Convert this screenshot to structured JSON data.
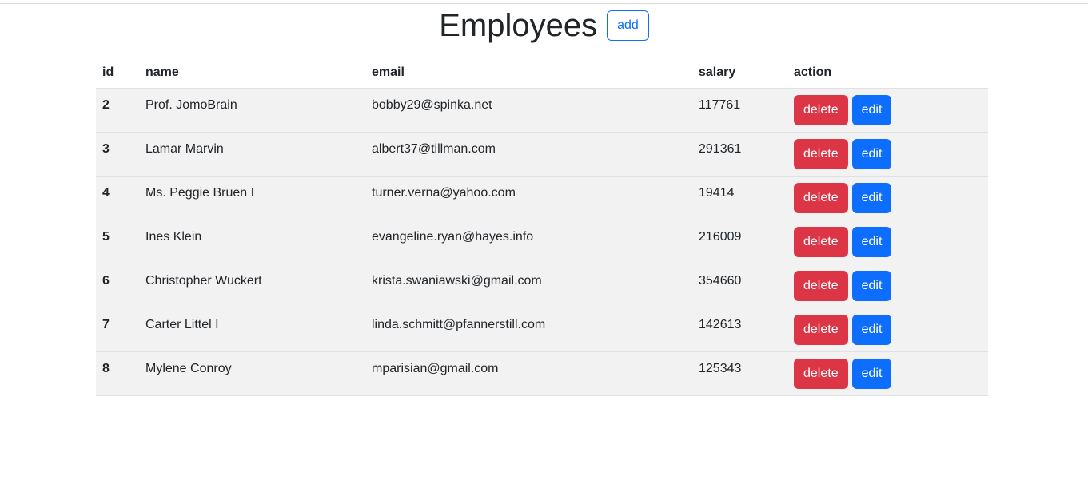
{
  "header": {
    "title": "Employees",
    "add_label": "add"
  },
  "table": {
    "columns": [
      "id",
      "name",
      "email",
      "salary",
      "action"
    ],
    "rows": [
      {
        "id": "2",
        "name": "Prof. JomoBrain",
        "email": "bobby29@spinka.net",
        "salary": "117761"
      },
      {
        "id": "3",
        "name": "Lamar Marvin",
        "email": "albert37@tillman.com",
        "salary": "291361"
      },
      {
        "id": "4",
        "name": "Ms. Peggie Bruen I",
        "email": "turner.verna@yahoo.com",
        "salary": "19414"
      },
      {
        "id": "5",
        "name": "Ines Klein",
        "email": "evangeline.ryan@hayes.info",
        "salary": "216009"
      },
      {
        "id": "6",
        "name": "Christopher Wuckert",
        "email": "krista.swaniawski@gmail.com",
        "salary": "354660"
      },
      {
        "id": "7",
        "name": "Carter Littel I",
        "email": "linda.schmitt@pfannerstill.com",
        "salary": "142613"
      },
      {
        "id": "8",
        "name": "Mylene Conroy",
        "email": "mparisian@gmail.com",
        "salary": "125343"
      }
    ],
    "delete_label": "delete",
    "edit_label": "edit"
  },
  "colors": {
    "delete": "#dc3545",
    "edit": "#0d6efd",
    "row_bg": "#f2f2f2"
  }
}
